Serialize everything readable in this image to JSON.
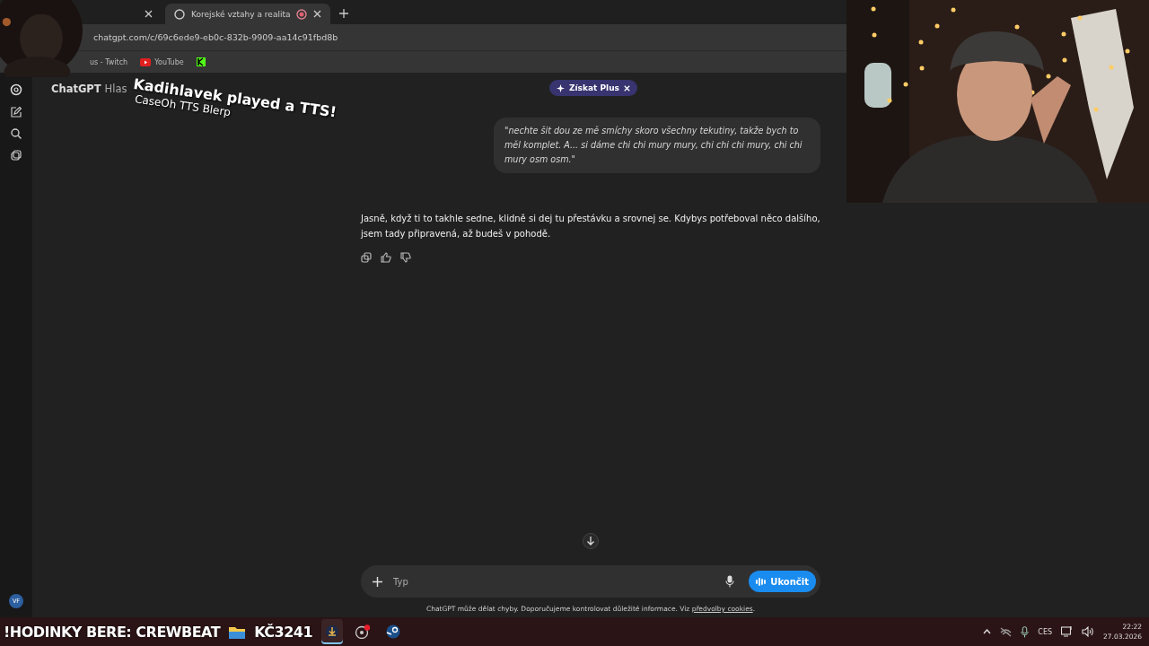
{
  "browser": {
    "tabs": [
      {
        "selected": false
      },
      {
        "title": "Korejské vztahy a realita",
        "selected": true,
        "recording": true
      }
    ],
    "url": "chatgpt.com/c/69c6ede9-eb0c-832b-9909-aa14c91fbd8b",
    "bookmarks": [
      {
        "kind": "twitch",
        "label": "us - Twitch"
      },
      {
        "kind": "youtube",
        "label": "YouTube"
      },
      {
        "kind": "kick"
      }
    ]
  },
  "header": {
    "title": "ChatGPT",
    "mode": "Hlas",
    "upgrade": "Získat Plus"
  },
  "messages": [
    {
      "kind": "user",
      "text": "\"nechte šit dou ze mě smíchy skoro všechny tekutiny, takže bych to měl komplet. A... si dáme chi chi mury mury, chi chi chi mury, chi chi mury osm osm.\""
    },
    {
      "kind": "assistant",
      "text": "Jasně, když ti to takhle sedne, klidně si dej tu přestávku a srovnej se. Kdybys potřeboval něco dalšího, jsem tady připravená, až budeš v pohodě."
    }
  ],
  "composer": {
    "placeholder": "Typ",
    "end_button": "Ukončit"
  },
  "footer": {
    "text": "ChatGPT může dělat chyby. Doporučujeme kontrolovat důležité informace. Viz",
    "link": "předvolby cookies",
    "end": "."
  },
  "sidebar": {
    "avatar": "VF"
  },
  "overlay": {
    "tts_title": "Kadihlavek played a TTS!",
    "tts_subtitle": "CaseOh TTS Blerp",
    "ticker": "!HODINKY BERE: CREWBEAT",
    "ticker_amount": "KČ3241"
  },
  "taskbar": {
    "apps": [
      {
        "kind": "download",
        "active": true
      },
      {
        "kind": "obs",
        "badge": true,
        "active": false
      },
      {
        "kind": "steam",
        "active": false
      }
    ],
    "language": "CES",
    "time": "22:22",
    "date": "27.03.2026"
  }
}
